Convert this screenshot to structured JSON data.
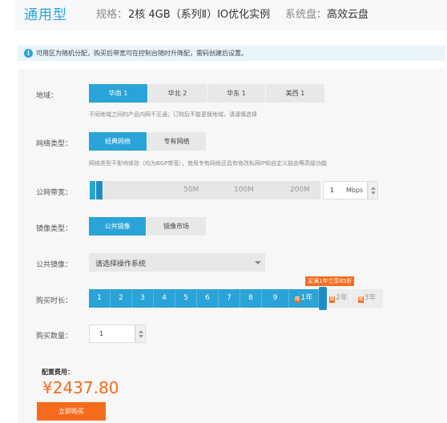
{
  "header": {
    "title": "通用型",
    "spec_label": "规格：",
    "spec_value": "2核 4GB（系列Ⅱ）IO优化实例",
    "disk_label": "系统盘：",
    "disk_value": "高效云盘"
  },
  "notice": {
    "icon": "info-icon",
    "icon_glyph": "i",
    "text": "可用区为随机分配，购买后带宽可在控制台随时升降配，需码创建后设置。"
  },
  "region": {
    "label": "地域：",
    "options": [
      "华南 1",
      "华北 2",
      "华东 1",
      "美西 1"
    ],
    "selected": "华南 1",
    "hint": "不同地域之间的产品内网不互通；订购后不能更换地域，请谨慎选择"
  },
  "network": {
    "label": "网络类型：",
    "options": [
      "经典网络",
      "专有网络"
    ],
    "selected": "经典网络",
    "hint": "网络类型不影响体验（均为BGP带宽），使用专有网络还具有修改私网IP和自定义路由等高级功能"
  },
  "bandwidth": {
    "label": "公网带宽：",
    "marks": [
      "50M",
      "100M",
      "200M"
    ],
    "value": "1",
    "unit": "Mbps",
    "level_fraction": 0.004
  },
  "image_type": {
    "label": "镜像类型：",
    "options": [
      "公共镜像",
      "镜像市场"
    ],
    "selected": "公共镜像"
  },
  "public_image": {
    "label": "公共镜像：",
    "placeholder": "请选择操作系统"
  },
  "duration": {
    "label": "购买时长：",
    "months": [
      "1",
      "2",
      "3",
      "4",
      "5",
      "6",
      "7",
      "8",
      "9"
    ],
    "year1": "1年",
    "year2": "2年",
    "year3": "3年",
    "promo": "买满1年立享85折",
    "gift_glyph": "赠"
  },
  "quantity": {
    "label": "购买数量：",
    "value": "1"
  },
  "price": {
    "label": "配置费用：",
    "value": "¥2437.80"
  },
  "buy_button": "立即购买",
  "colors": {
    "accent": "#2aa3d8",
    "orange": "#f66b1b"
  }
}
